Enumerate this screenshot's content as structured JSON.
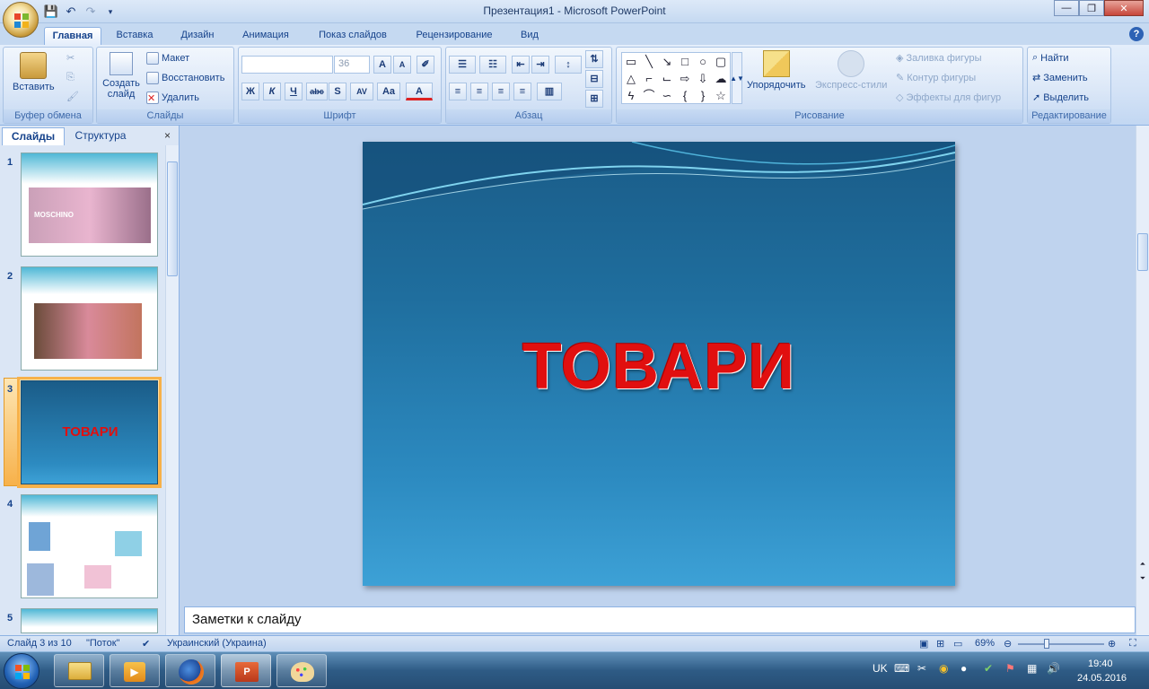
{
  "window": {
    "title": "Презентация1 - Microsoft PowerPoint"
  },
  "tabs": [
    "Главная",
    "Вставка",
    "Дизайн",
    "Анимация",
    "Показ слайдов",
    "Рецензирование",
    "Вид"
  ],
  "ribbon": {
    "clipboard": {
      "paste": "Вставить",
      "label": "Буфер обмена"
    },
    "slides": {
      "new_slide": "Создать слайд",
      "layout": "Макет",
      "reset": "Восстановить",
      "delete": "Удалить",
      "label": "Слайды"
    },
    "font": {
      "size": "36",
      "label": "Шрифт",
      "bold": "Ж",
      "italic": "К",
      "underline": "Ч",
      "strike": "abc",
      "shadow": "S"
    },
    "paragraph": {
      "label": "Абзац"
    },
    "drawing": {
      "arrange": "Упорядочить",
      "quick_styles": "Экспресс-стили",
      "fill": "Заливка фигуры",
      "outline": "Контур фигуры",
      "effects": "Эффекты для фигур",
      "label": "Рисование"
    },
    "editing": {
      "find": "Найти",
      "replace": "Заменить",
      "select": "Выделить",
      "label": "Редактирование"
    }
  },
  "pane": {
    "tab_slides": "Слайды",
    "tab_outline": "Структура"
  },
  "thumbnails": [
    {
      "num": "1",
      "title": "MOSCHINO"
    },
    {
      "num": "2",
      "title": ""
    },
    {
      "num": "3",
      "title": "ТОВАРИ"
    },
    {
      "num": "4",
      "title": ""
    },
    {
      "num": "5",
      "title": ""
    }
  ],
  "slide": {
    "title": "ТОВАРИ"
  },
  "notes": {
    "placeholder": "Заметки к слайду"
  },
  "status": {
    "slide_info": "Слайд 3 из 10",
    "theme": "\"Поток\"",
    "language": "Украинский (Украина)",
    "zoom": "69%"
  },
  "tray": {
    "lang": "UK",
    "time": "19:40",
    "date": "24.05.2016"
  },
  "colors": {
    "title_red": "#e10f0f",
    "slide_bg": "#1f6e9e",
    "selection": "#f7b14a"
  }
}
